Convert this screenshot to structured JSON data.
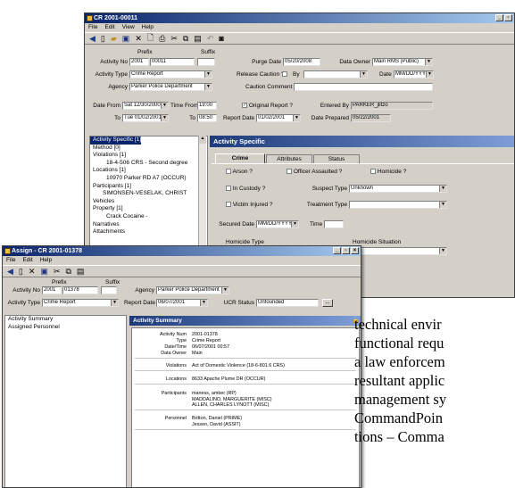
{
  "back_window": {
    "title": "CR 2001-00011",
    "menu": [
      "File",
      "Edit",
      "View",
      "Help"
    ],
    "labels": {
      "prefix": "Prefix",
      "suffix": "Suffix",
      "activity_no": "Activity No",
      "activity_type": "Activity Type",
      "agency": "Agency",
      "purge_date": "Purge Date",
      "data_owner": "Data Owner",
      "release_caution": "Release Caution ?",
      "by": "By",
      "date": "Date",
      "caution_comment": "Caution Comment",
      "date_from": "Date From",
      "to": "To",
      "time_from": "Time From",
      "original_report": "Original Report ?",
      "entered_by": "Entered By",
      "report_date": "Report Date",
      "date_prepared": "Date Prepared"
    },
    "values": {
      "activity_prefix": "2001",
      "activity_no": "00011",
      "activity_type": "Crime Report",
      "agency": "Parker Police Department",
      "purge_date": "05/20/2008",
      "data_owner": "Main RMS (Public)",
      "date_placeholder": "MM/DD/YYYY",
      "date_from": "Sat 12/30/2000",
      "date_to": "Tue 01/02/2001",
      "time_from": "19:00",
      "time_to": "08:50",
      "report_date": "01/02/2001",
      "entered_by": "PARKER_jlitzo",
      "date_prepared": "05/22/2001"
    },
    "tree": [
      "Activity Specific [1]",
      "Method [0]",
      "Violations [1]",
      "18-4-506 CRS - Second degree",
      "Locations [1]",
      "10970 Parker RD A7 (OCCUR)",
      "Participants [1]",
      "SIMONSEN-VESELAK, CHRIST",
      "Vehicles",
      "Property [1]",
      "Crack Cocaine -",
      "Narratives",
      "Attachments"
    ],
    "panel_title": "Activity Specific",
    "tabs": [
      "Crime",
      "Attributes",
      "Status"
    ],
    "fields": {
      "arson": "Arson ?",
      "officer_assaulted": "Officer Assaulted ?",
      "homicide": "Homicide ?",
      "in_custody": "In Custody ?",
      "suspect_type": "Suspect Type",
      "suspect_type_value": "Unknown",
      "victim_injured": "Victim Injured ?",
      "treatment_type": "Treatment Type",
      "secured_date": "Secured Date",
      "secured_date_value": "MM/DD/YYYY",
      "time": "Time",
      "homicide_type": "Homicide Type",
      "homicide_situation": "Homicide Situation"
    }
  },
  "front_window": {
    "title": "Assign - CR 2001-01378",
    "menu": [
      "File",
      "Edit",
      "Help"
    ],
    "labels": {
      "prefix": "Prefix",
      "suffix": "Suffix",
      "activity_no": "Activity No",
      "activity_type": "Activity Type",
      "agency": "Agency",
      "report_date": "Report Date",
      "ucr_status": "UCR Status"
    },
    "values": {
      "activity_prefix": "2001",
      "activity_no": "01378",
      "activity_type": "Crime Report",
      "agency": "Parker Police Department",
      "report_date": "06/07/2001",
      "ucr_status": "Unfounded"
    },
    "tree": [
      "Activity Summary",
      "Assigned Personnel"
    ],
    "panel_title": "Activity Summary",
    "summary": [
      {
        "k": "Activity Num",
        "v": [
          "2001-01378"
        ]
      },
      {
        "k": "Type",
        "v": [
          "Crime Report"
        ]
      },
      {
        "k": "Date/Time",
        "v": [
          "06/07/2001 00:57"
        ]
      },
      {
        "k": "Data Owner",
        "v": [
          "Main"
        ]
      },
      {
        "k": "Violations",
        "v": [
          "Act of Domestic Violence (18-6-801.6 CRS)"
        ]
      },
      {
        "k": "Locations",
        "v": [
          "8633 Apache Plume DR (OCCUR)"
        ]
      },
      {
        "k": "Participants",
        "v": [
          "maness, amber (RP)",
          "MADDALINO, MARGUERITE (MISC)",
          "ALLEN, CHARLES LYNOTT (MISC)"
        ]
      },
      {
        "k": "Personnel",
        "v": [
          "Britton, Daniel (PRIME)",
          "Jessen, David (ASSIT)"
        ]
      }
    ]
  },
  "body_text": [
    "technical envir",
    "functional requ",
    "a law enforcem",
    "resultant applic",
    "management sy",
    "CommandPoin",
    "tions – Comma"
  ]
}
